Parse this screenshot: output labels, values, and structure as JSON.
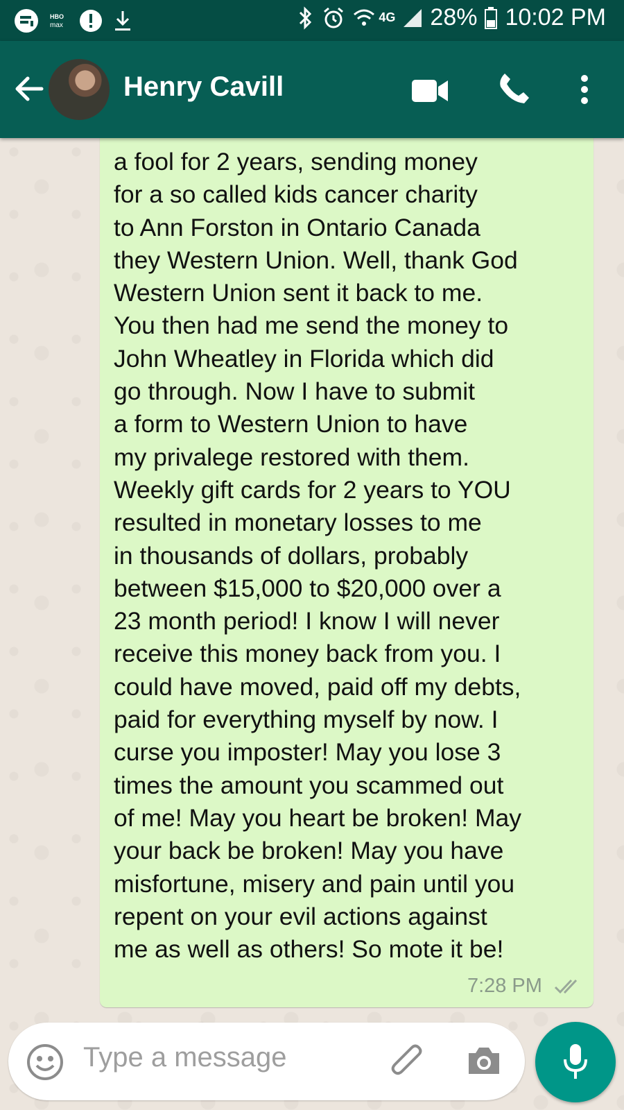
{
  "status_bar": {
    "battery": "28%",
    "time": "10:02 PM",
    "network": "4G"
  },
  "header": {
    "contact_name": "Henry Cavill"
  },
  "message": {
    "text": "a fool for 2 years, sending money\nfor a so called kids cancer charity\nto Ann Forston in Ontario Canada\nthey Western Union. Well, thank God\nWestern Union sent it back to me.\nYou then had me send the money to\nJohn Wheatley in Florida which did\ngo through. Now I have to submit\na form to Western Union to have\nmy privalege restored with them.\nWeekly gift cards for 2 years to YOU\nresulted in monetary losses to me\nin thousands of dollars, probably\nbetween $15,000 to $20,000 over a\n23 month period! I know I will never\nreceive this money back from you. I\ncould have moved, paid off my debts,\npaid for everything myself by now. I\ncurse you imposter! May you lose 3\ntimes the amount you scammed out\nof me! May you heart be broken! May\nyour back be broken! May you have\nmisfortune, misery and pain until you\nrepent on your evil actions against\nme as well as others! So mote it be!",
    "time": "7:28 PM"
  },
  "composer": {
    "placeholder": "Type a message"
  },
  "colors": {
    "header": "#075e54",
    "status_bar": "#054d44",
    "bubble": "#dcf8c6",
    "mic_button": "#009688"
  }
}
